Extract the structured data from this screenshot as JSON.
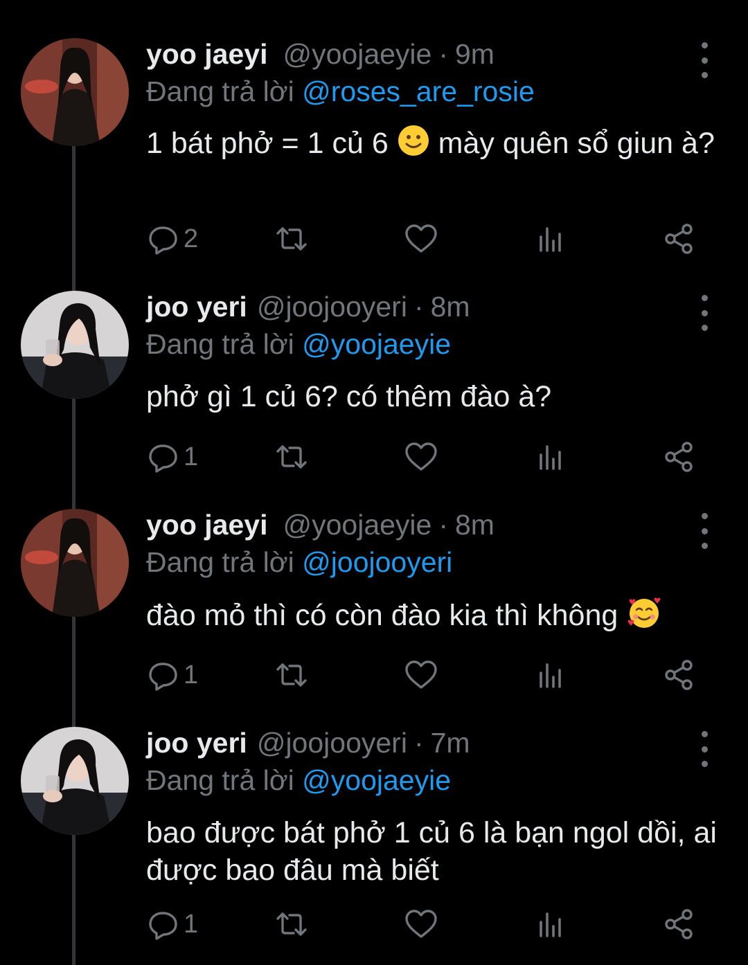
{
  "tweets": [
    {
      "name": "yoo jaeyi",
      "handle": "@yoojaeyie",
      "time": "9m",
      "replying_label": "Đang trả lời",
      "replying_to": "@roses_are_rosie",
      "text_a": "1 bát phở = 1 củ 6 ",
      "text_emoji": "slightly-smiling-face-emoji",
      "text_b": " mày quên sổ giun à?",
      "reply_count": "2"
    },
    {
      "name": "joo yeri",
      "handle": "@joojooyeri",
      "time": "8m",
      "replying_label": "Đang trả lời",
      "replying_to": "@yoojaeyie",
      "text_a": "phở gì 1 củ 6? có thêm đào à?",
      "reply_count": "1"
    },
    {
      "name": "yoo jaeyi",
      "handle": "@yoojaeyie",
      "time": "8m",
      "replying_label": "Đang trả lời",
      "replying_to": "@joojooyeri",
      "text_a": "đào mỏ thì có còn đào kia thì không ",
      "text_emoji": "smiling-face-with-hearts-emoji",
      "reply_count": "1"
    },
    {
      "name": "joo yeri",
      "handle": "@joojooyeri",
      "time": "7m",
      "replying_label": "Đang trả lời",
      "replying_to": "@yoojaeyie",
      "text_a": "bao được bát phở 1 củ 6 là bạn ngol dồi, ai được bao đâu mà biết",
      "reply_count": "1"
    }
  ],
  "icons": {
    "reply": "reply-icon",
    "retweet": "retweet-icon",
    "like": "like-icon",
    "views": "views-icon",
    "share": "share-icon",
    "more": "more-vertical-icon"
  },
  "colors": {
    "background": "#000000",
    "text": "#e7e9ea",
    "secondary": "#71767b",
    "accent": "#1d9bf0",
    "thread_line": "#333639"
  }
}
